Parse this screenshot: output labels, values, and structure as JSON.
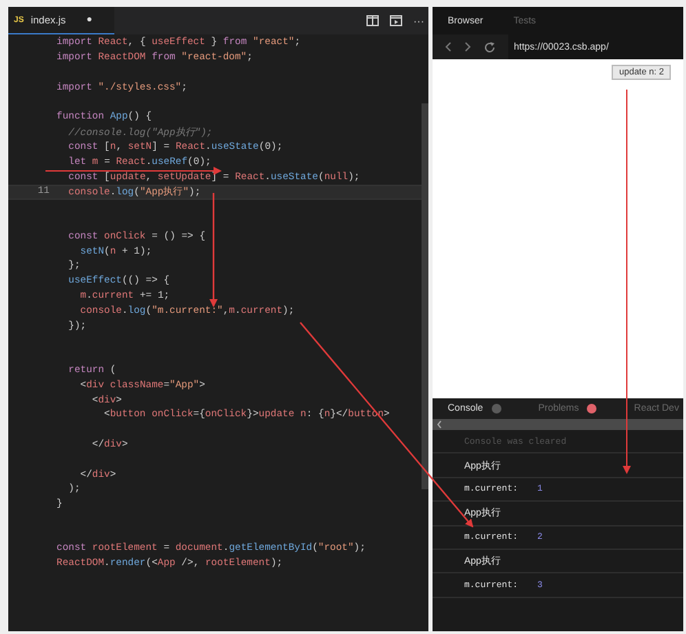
{
  "editor": {
    "tab": {
      "icon_text": "JS",
      "filename": "index.js",
      "modified_mark": "●"
    },
    "more_menu": "···",
    "lines": [
      {
        "text": "import React, { useEffect } from \"react\";",
        "current": false
      },
      {
        "text": "import ReactDOM from \"react-dom\";",
        "current": false
      },
      {
        "current": false
      },
      {
        "text": "import \"./styles.css\";",
        "current": false
      },
      {
        "current": false
      },
      {
        "text": "function App() {",
        "current": false
      },
      {
        "text": "  //console.log(\"App执行\");",
        "current": false
      },
      {
        "text": "  const [n, setN] = React.useState(0);",
        "current": false
      },
      {
        "text": "  let m = React.useRef(0);",
        "current": false
      },
      {
        "text": "  const [update, setUpdate] = React.useState(null);",
        "current": false
      },
      {
        "text": "  console.log(\"App执行\");",
        "current": true,
        "number": "11"
      },
      {
        "current": false
      },
      {
        "current": false
      },
      {
        "text": "  const onClick = () => {",
        "current": false
      },
      {
        "text": "    setN(n + 1);",
        "current": false
      },
      {
        "text": "  };",
        "current": false
      },
      {
        "text": "  useEffect(() => {",
        "current": false
      },
      {
        "text": "    m.current += 1;",
        "current": false
      },
      {
        "text": "    console.log(\"m.current:\",m.current);",
        "current": false
      },
      {
        "text": "  });",
        "current": false
      },
      {
        "current": false
      },
      {
        "current": false
      },
      {
        "text": "  return (",
        "current": false
      },
      {
        "text": "    <div className=\"App\">",
        "current": false
      },
      {
        "text": "      <div>",
        "current": false
      },
      {
        "text": "        <button onClick={onClick}>update n: {n}</button>",
        "current": false
      },
      {
        "current": false
      },
      {
        "text": "      </div>",
        "current": false
      },
      {
        "current": false
      },
      {
        "text": "    </div>",
        "current": false
      },
      {
        "text": "  );",
        "current": false
      },
      {
        "text": "}",
        "current": false
      },
      {
        "current": false
      },
      {
        "current": false
      },
      {
        "text": "const rootElement = document.getElementById(\"root\");",
        "current": false
      },
      {
        "text": "ReactDOM.render(<App />, rootElement);",
        "current": false
      }
    ]
  },
  "preview": {
    "tabs": [
      {
        "label": "Browser",
        "selected": true
      },
      {
        "label": "Tests",
        "selected": false
      }
    ],
    "url": "https://00023.csb.app/",
    "page_button": "update n: 2",
    "console_tabs": [
      {
        "label": "Console",
        "selected": true,
        "color": "#5a5a5a"
      },
      {
        "label": "Problems",
        "selected": false,
        "color": "#e0626a"
      },
      {
        "label": "React Dev",
        "selected": false
      }
    ],
    "console_rows": [
      {
        "kind": "info",
        "text": "Console was cleared"
      },
      {
        "kind": "log",
        "text": "App执行"
      },
      {
        "kind": "log",
        "text": "m.current:",
        "value": "1"
      },
      {
        "kind": "log",
        "text": "App执行"
      },
      {
        "kind": "log",
        "text": "m.current:",
        "value": "2"
      },
      {
        "kind": "log",
        "text": "App执行"
      },
      {
        "kind": "log",
        "text": "m.current:",
        "value": "3"
      }
    ]
  }
}
